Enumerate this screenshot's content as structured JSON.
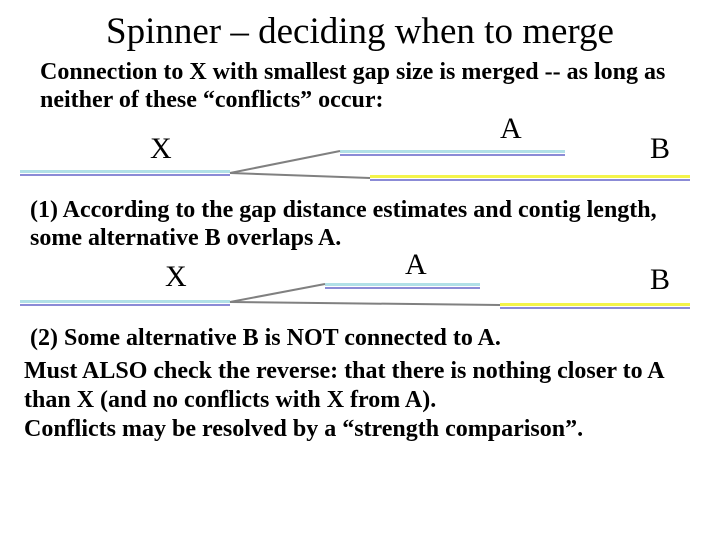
{
  "title": "Spinner – deciding when to merge",
  "intro": "Connection to X with smallest gap size is merged -- as long as neither of these “conflicts” occur:",
  "labels": {
    "X": "X",
    "A": "A",
    "B": "B"
  },
  "cond1": "(1) According to the gap distance estimates and contig length, some alternative B overlaps A.",
  "cond2": "(2) Some alternative B is NOT connected to A.",
  "final_lines": [
    "Must ALSO check the reverse: that there is nothing closer to A than X (and no conflicts with X from A).",
    "Conflicts may be resolved by a “strength comparison”."
  ]
}
